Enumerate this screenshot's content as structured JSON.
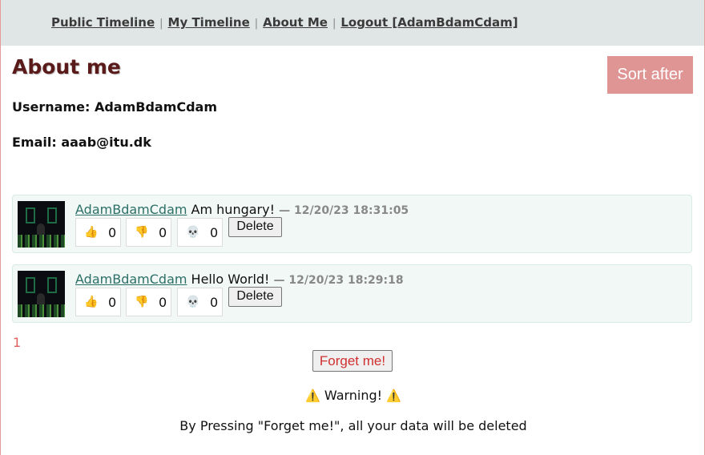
{
  "nav": {
    "links": [
      "Public Timeline",
      "My Timeline",
      "About Me",
      "Logout [AdamBdamCdam]"
    ],
    "separator": "|"
  },
  "page": {
    "title": "About me",
    "sort_label": "Sort after",
    "username_label": "Username: AdamBdamCdam",
    "email_label": "Email: aaab@itu.dk"
  },
  "messages": [
    {
      "user": "AdamBdamCdam",
      "text": "Am hungary!",
      "date": "— 12/20/23 18:31:05",
      "reactions": [
        {
          "icon": "thumbs-up-icon",
          "glyph": "👍",
          "count": "0"
        },
        {
          "icon": "thumbs-down-icon",
          "glyph": "👎",
          "count": "0"
        },
        {
          "icon": "skull-icon",
          "glyph": "💀",
          "count": "0"
        }
      ],
      "delete_label": "Delete"
    },
    {
      "user": "AdamBdamCdam",
      "text": "Hello World!",
      "date": "— 12/20/23 18:29:18",
      "reactions": [
        {
          "icon": "thumbs-up-icon",
          "glyph": "👍",
          "count": "0"
        },
        {
          "icon": "thumbs-down-icon",
          "glyph": "👎",
          "count": "0"
        },
        {
          "icon": "skull-icon",
          "glyph": "💀",
          "count": "0"
        }
      ],
      "delete_label": "Delete"
    }
  ],
  "pagination": {
    "current_page": "1"
  },
  "forget": {
    "button_label": "Forget me!",
    "warning_title": "Warning!",
    "warning_icon": "⚠️",
    "warning_text": "By Pressing \"Forget me!\", all your data will be deleted"
  },
  "colors": {
    "navbar_bg": "#dfe6e5",
    "title": "#5a1a1a",
    "sort_button_bg": "#e09595",
    "message_bg": "#f1f8f6",
    "username_link": "#2b6f66",
    "forget_text": "#d03030"
  }
}
